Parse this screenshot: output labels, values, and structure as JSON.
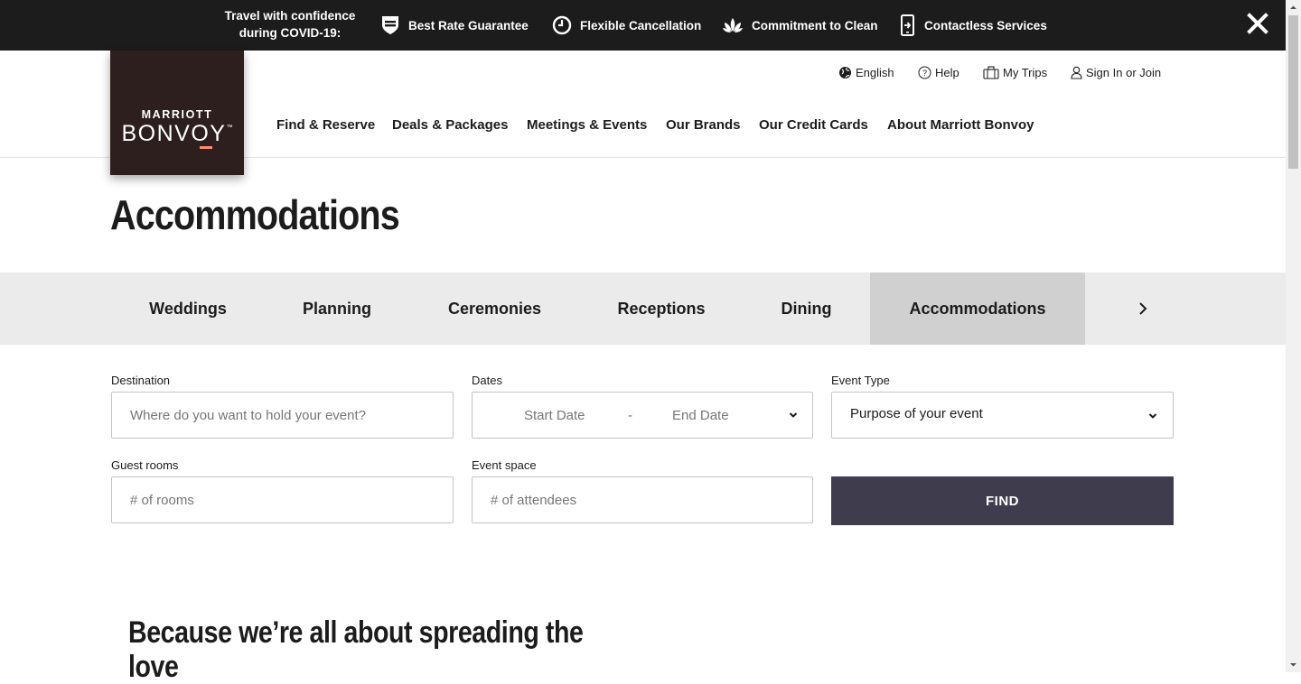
{
  "covid_bar": {
    "intro_line1": "Travel with confidence",
    "intro_line2": "during COVID-19:",
    "items": [
      {
        "label": "Best Rate Guarantee",
        "icon": "shield-icon"
      },
      {
        "label": "Flexible Cancellation",
        "icon": "clock-icon"
      },
      {
        "label": "Commitment to Clean",
        "icon": "lotus-icon"
      },
      {
        "label": "Contactless Services",
        "icon": "phone-icon"
      }
    ],
    "close_icon": "close-icon"
  },
  "logo": {
    "line1": "MARRIOTT",
    "line2": "BONVOY",
    "accent_color": "#ff8d6b",
    "background": "#2c1f1d"
  },
  "utility_nav": [
    {
      "label": "English",
      "icon": "globe-icon"
    },
    {
      "label": "Help",
      "icon": "help-icon"
    },
    {
      "label": "My Trips",
      "icon": "suitcase-icon"
    },
    {
      "label": "Sign In or Join",
      "icon": "user-icon"
    }
  ],
  "main_nav": [
    "Find & Reserve",
    "Deals & Packages",
    "Meetings & Events",
    "Our Brands",
    "Our Credit Cards",
    "About Marriott Bonvoy"
  ],
  "page_title": "Accommodations",
  "tabs": [
    {
      "label": "Weddings",
      "active": false
    },
    {
      "label": "Planning",
      "active": false
    },
    {
      "label": "Ceremonies",
      "active": false
    },
    {
      "label": "Receptions",
      "active": false
    },
    {
      "label": "Dining",
      "active": false
    },
    {
      "label": "Accommodations",
      "active": true
    }
  ],
  "form": {
    "destination": {
      "label": "Destination",
      "placeholder": "Where do you want to hold your event?"
    },
    "dates": {
      "label": "Dates",
      "start": "Start Date",
      "separator": "-",
      "end": "End Date"
    },
    "event_type": {
      "label": "Event Type",
      "value": "Purpose of your event"
    },
    "guest_rooms": {
      "label": "Guest rooms",
      "placeholder": "# of rooms"
    },
    "event_space": {
      "label": "Event space",
      "placeholder": "# of attendees"
    },
    "find_label": "FIND",
    "find_color": "#3f3c4d"
  },
  "section_heading": "Because we’re all about spreading the love"
}
